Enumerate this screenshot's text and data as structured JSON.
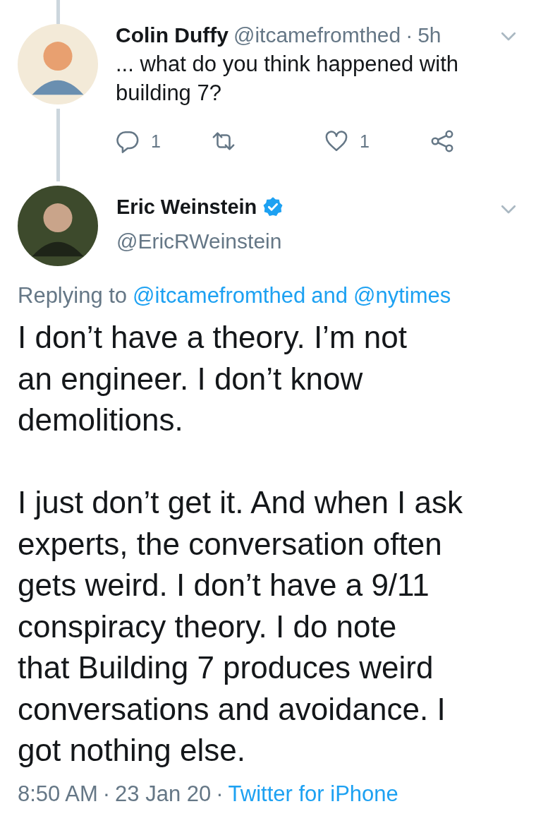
{
  "reply_tweet": {
    "name": "Colin Duffy",
    "handle": "@itcamefromthed",
    "separator": "·",
    "time": "5h",
    "text": "... what do you think happened with\nbuilding 7?",
    "reply_count": "1",
    "like_count": "1"
  },
  "main_tweet": {
    "name": "Eric Weinstein",
    "verified": true,
    "handle": "@EricRWeinstein",
    "replying_prefix": "Replying to",
    "replying_to": [
      "@itcamefromthed",
      "@nytimes"
    ],
    "replying_joiner": "and",
    "text": "I don’t have a theory. I’m not\nan engineer. I don’t know\ndemolitions.\n\nI just don’t get it. And when I ask\nexperts, the conversation often\ngets weird. I don’t have a 9/11\nconspiracy theory. I do note\nthat Building 7 produces weird\nconversations and avoidance. I\ngot nothing else.",
    "time": "8:50 AM",
    "separator_1": "·",
    "date": "23 Jan 20",
    "separator_2": "·",
    "source": "Twitter for iPhone"
  }
}
